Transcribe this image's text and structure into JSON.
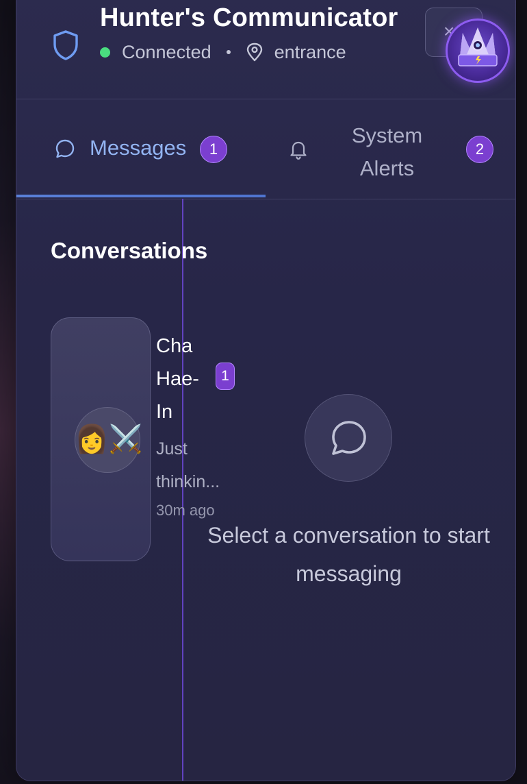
{
  "header": {
    "title": "Hunter's Communicator",
    "status": "Connected",
    "location": "entrance",
    "close_label": "×",
    "status_color": "#4ade80"
  },
  "tabs": [
    {
      "label": "Messages",
      "badge": "1",
      "active": true,
      "icon": "chat-bubble-icon"
    },
    {
      "label": "System Alerts",
      "badge": "2",
      "active": false,
      "icon": "bell-icon"
    }
  ],
  "conversations": {
    "title": "Conversations",
    "items": [
      {
        "name": "Cha Hae-In",
        "avatar": "👩⚔️",
        "unread": "1",
        "preview": "Just thinkin...",
        "time": "30m ago"
      }
    ]
  },
  "empty_state": {
    "text": "Select a conversation to start messaging",
    "icon": "chat-bubble-icon"
  },
  "colors": {
    "accent": "#7b3fd0",
    "active_tab": "#93b4f2",
    "divider": "#6c48d6"
  }
}
